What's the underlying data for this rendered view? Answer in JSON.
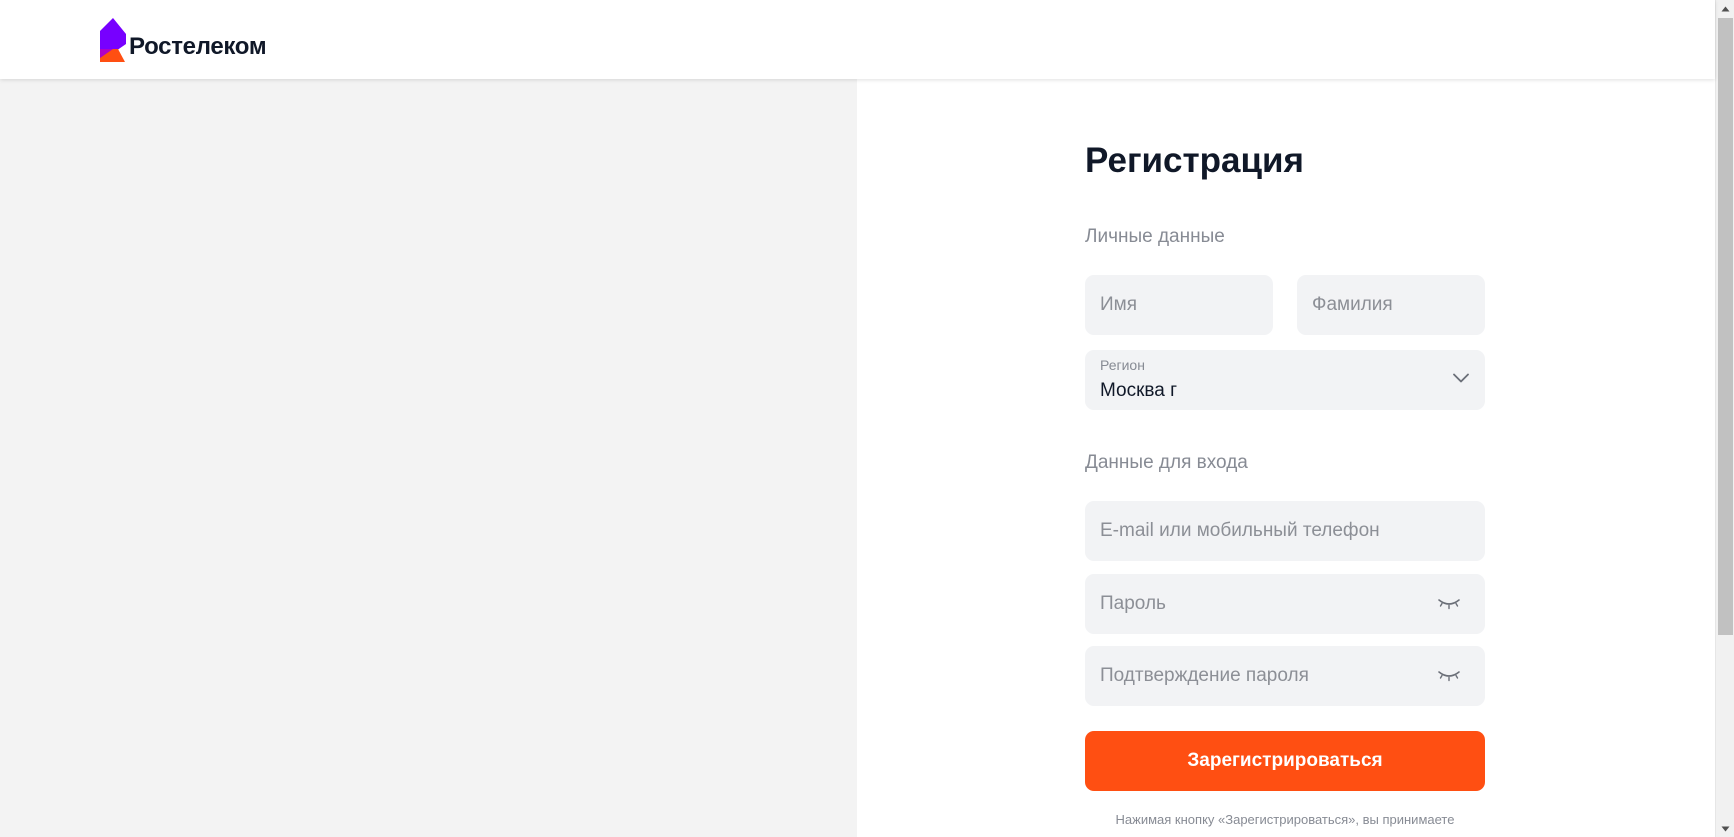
{
  "header": {
    "brand_name": "Ростелеком"
  },
  "form": {
    "title": "Регистрация",
    "personal_section_label": "Личные данные",
    "first_name": {
      "placeholder": "Имя",
      "value": ""
    },
    "last_name": {
      "placeholder": "Фамилия",
      "value": ""
    },
    "region": {
      "label": "Регион",
      "value": "Москва г"
    },
    "login_section_label": "Данные для входа",
    "login": {
      "placeholder": "E-mail или мобильный телефон",
      "value": ""
    },
    "password": {
      "placeholder": "Пароль",
      "value": ""
    },
    "password_confirm": {
      "placeholder": "Подтверждение пароля",
      "value": ""
    },
    "submit_label": "Зарегистрироваться",
    "terms_text": "Нажимая кнопку «Зарегистрироваться», вы принимаете"
  },
  "icons": {
    "logo": "rostelecom-logo-icon",
    "region_toggle": "chevron-down-icon",
    "password_visibility": "eye-closed-icon",
    "scroll_up": "arrow-up-icon",
    "scroll_down": "arrow-down-icon"
  },
  "colors": {
    "accent": "#ff4f12",
    "brand_purple": "#7700ff",
    "text_primary": "#101828",
    "text_secondary": "#878b94",
    "field_background": "#f2f3f5",
    "left_panel_background": "#f3f3f3"
  }
}
